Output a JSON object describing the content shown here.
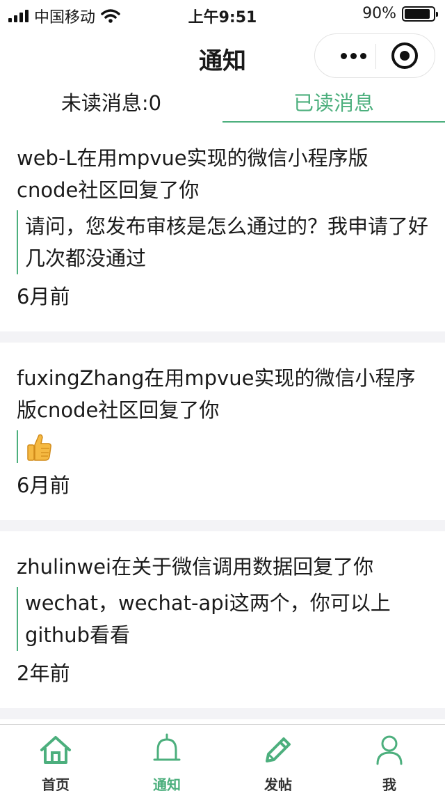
{
  "status_bar": {
    "carrier": "中国移动",
    "time": "上午9:51",
    "battery": "90%",
    "battery_level": 0.9
  },
  "nav": {
    "title": "通知"
  },
  "tabs": [
    {
      "label": "未读消息:0",
      "active": false
    },
    {
      "label": "已读消息",
      "active": true
    }
  ],
  "messages": [
    {
      "title": "web-L在用mpvue实现的微信小程序版cnode社区回复了你",
      "content": "请问，您发布审核是怎么通过的？我申请了好几次都没通过",
      "time": "6月前"
    },
    {
      "title": "fuxingZhang在用mpvue实现的微信小程序版cnode社区回复了你",
      "content": "thumbs-up-emoji",
      "time": "6月前"
    },
    {
      "title": "zhulinwei在关于微信调用数据回复了你",
      "content": "wechat，wechat-api这两个，你可以上github看看",
      "time": "2年前"
    }
  ],
  "tabbar": [
    {
      "label": "首页",
      "icon": "home-icon",
      "active": false
    },
    {
      "label": "通知",
      "icon": "bell-icon",
      "active": true
    },
    {
      "label": "发帖",
      "icon": "pencil-icon",
      "active": false
    },
    {
      "label": "我",
      "icon": "user-icon",
      "active": false
    }
  ],
  "colors": {
    "accent": "#4caf7d",
    "separator": "#f3f3f6",
    "text": "#1a1a1a"
  }
}
